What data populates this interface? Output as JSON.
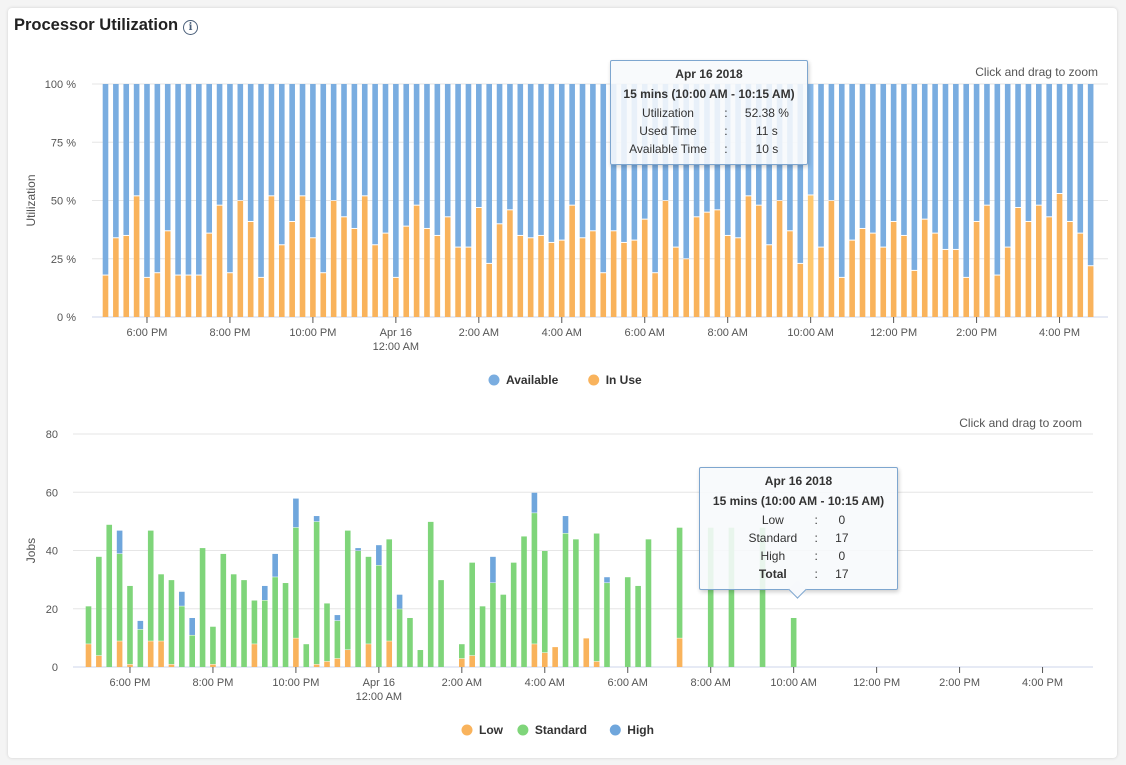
{
  "page": {
    "title": "Processor Utilization",
    "info_icon": "info-circle-icon"
  },
  "chart_data": [
    {
      "type": "bar",
      "stacked": true,
      "title": "Processor Utilization",
      "ylabel": "Utilization",
      "ylim": [
        0,
        100
      ],
      "y_ticks": [
        "0 %",
        "25 %",
        "50 %",
        "75 %",
        "100 %"
      ],
      "y_tick_values": [
        0,
        25,
        50,
        75,
        100
      ],
      "x_ticks": [
        {
          "index": 4,
          "label": "6:00 PM"
        },
        {
          "index": 12,
          "label": "8:00 PM"
        },
        {
          "index": 20,
          "label": "10:00 PM"
        },
        {
          "index": 28,
          "label": "Apr 16",
          "label2": "12:00 AM"
        },
        {
          "index": 36,
          "label": "2:00 AM"
        },
        {
          "index": 44,
          "label": "4:00 AM"
        },
        {
          "index": 52,
          "label": "6:00 AM"
        },
        {
          "index": 60,
          "label": "8:00 AM"
        },
        {
          "index": 68,
          "label": "10:00 AM"
        },
        {
          "index": 76,
          "label": "12:00 PM"
        },
        {
          "index": 84,
          "label": "2:00 PM"
        },
        {
          "index": 92,
          "label": "4:00 PM"
        }
      ],
      "interval": "15 mins",
      "zoom_hint": "Click and drag to zoom",
      "legend": [
        {
          "name": "Available",
          "color": "#7aade0"
        },
        {
          "name": "In Use",
          "color": "#f9b35c"
        }
      ],
      "legend_position": "bottom",
      "series": [
        {
          "name": "In Use",
          "color": "#f9b35c",
          "values": [
            18,
            34,
            35,
            52,
            17,
            19,
            37,
            18,
            18,
            18,
            36,
            48,
            19,
            50,
            41,
            17,
            52,
            31,
            41,
            52,
            34,
            19,
            50,
            43,
            38,
            52,
            31,
            36,
            17,
            39,
            48,
            38,
            35,
            43,
            30,
            30,
            47,
            23,
            40,
            46,
            35,
            34,
            35,
            32,
            33,
            48,
            34,
            37,
            19,
            37,
            32,
            33,
            42,
            19,
            50,
            30,
            25,
            43,
            45,
            46,
            35,
            34,
            52,
            48,
            31,
            50,
            37,
            23,
            52.38,
            30,
            50,
            17,
            33,
            38,
            36,
            30,
            41,
            35,
            20,
            42,
            36,
            29,
            29,
            17,
            41,
            48,
            18,
            30,
            47,
            41,
            48,
            43,
            53,
            41,
            36,
            22
          ]
        },
        {
          "name": "Available",
          "color": "#7aade0",
          "note": "100 minus In Use"
        }
      ],
      "highlight_index": 68,
      "tooltip": {
        "date": "Apr 16 2018",
        "range": "15 mins (10:00 AM - 10:15 AM)",
        "rows": [
          {
            "label": "Utilization",
            "value": "52.38 %"
          },
          {
            "label": "Used Time",
            "value": "11 s"
          },
          {
            "label": "Available Time",
            "value": "10 s"
          }
        ]
      }
    },
    {
      "type": "bar",
      "stacked": true,
      "ylabel": "Jobs",
      "ylim": [
        0,
        80
      ],
      "y_ticks": [
        "0",
        "20",
        "40",
        "60",
        "80"
      ],
      "y_tick_values": [
        0,
        20,
        40,
        60,
        80
      ],
      "x_ticks": [
        {
          "index": 4,
          "label": "6:00 PM"
        },
        {
          "index": 12,
          "label": "8:00 PM"
        },
        {
          "index": 20,
          "label": "10:00 PM"
        },
        {
          "index": 28,
          "label": "Apr 16",
          "label2": "12:00 AM"
        },
        {
          "index": 36,
          "label": "2:00 AM"
        },
        {
          "index": 44,
          "label": "4:00 AM"
        },
        {
          "index": 52,
          "label": "6:00 AM"
        },
        {
          "index": 60,
          "label": "8:00 AM"
        },
        {
          "index": 68,
          "label": "10:00 AM"
        },
        {
          "index": 76,
          "label": "12:00 PM"
        },
        {
          "index": 84,
          "label": "2:00 PM"
        },
        {
          "index": 92,
          "label": "4:00 PM"
        }
      ],
      "zoom_hint": "Click and drag to zoom",
      "legend": [
        {
          "name": "Low",
          "color": "#f9b35c"
        },
        {
          "name": "Standard",
          "color": "#7fd57a"
        },
        {
          "name": "High",
          "color": "#6fa6dc"
        }
      ],
      "legend_position": "bottom",
      "series": [
        {
          "name": "Low",
          "color": "#f9b35c",
          "values": [
            8,
            4,
            0,
            9,
            1,
            0,
            9,
            9,
            1,
            0,
            0,
            0,
            1,
            0,
            0,
            0,
            8,
            0,
            0,
            0,
            10,
            0,
            1,
            2,
            3,
            6,
            0,
            8,
            0,
            9,
            0,
            0,
            0,
            0,
            0,
            0,
            3,
            4,
            0,
            0,
            0,
            0,
            0,
            8,
            5,
            7,
            0,
            0,
            10,
            2,
            0,
            0,
            0,
            0,
            0,
            0,
            0,
            10,
            0,
            0,
            0,
            0,
            0,
            0,
            0,
            0,
            0,
            0,
            0,
            0,
            0,
            0,
            0,
            0,
            0,
            0,
            0,
            0,
            0,
            0,
            0,
            0,
            0,
            0,
            0,
            0,
            0,
            0,
            0,
            0,
            0,
            0,
            0,
            0,
            0,
            0
          ]
        },
        {
          "name": "Standard",
          "color": "#7fd57a",
          "values": [
            13,
            34,
            49,
            30,
            27,
            13,
            38,
            23,
            29,
            21,
            11,
            41,
            13,
            39,
            32,
            30,
            15,
            23,
            31,
            29,
            38,
            8,
            49,
            20,
            13,
            41,
            40,
            30,
            35,
            35,
            20,
            17,
            6,
            50,
            30,
            0,
            5,
            32,
            21,
            29,
            25,
            36,
            45,
            45,
            35,
            0,
            46,
            44,
            0,
            44,
            29,
            0,
            31,
            28,
            44,
            0,
            0,
            38,
            0,
            0,
            48,
            0,
            48,
            0,
            0,
            48,
            0,
            0,
            17,
            0,
            0,
            0,
            0,
            0,
            0,
            0,
            0,
            0,
            0,
            0,
            0,
            0,
            0,
            0,
            0,
            0,
            0,
            0,
            0,
            0,
            0,
            0,
            0,
            0,
            0,
            0
          ]
        },
        {
          "name": "High",
          "color": "#6fa6dc",
          "values": [
            0,
            0,
            0,
            8,
            0,
            3,
            0,
            0,
            0,
            5,
            6,
            0,
            0,
            0,
            0,
            0,
            0,
            5,
            8,
            0,
            10,
            0,
            2,
            0,
            2,
            0,
            1,
            0,
            7,
            0,
            5,
            0,
            0,
            0,
            0,
            0,
            0,
            0,
            0,
            9,
            0,
            0,
            0,
            7,
            0,
            0,
            6,
            0,
            0,
            0,
            2,
            0,
            0,
            0,
            0,
            0,
            0,
            0,
            0,
            0,
            0,
            0,
            0,
            0,
            0,
            0,
            0,
            0,
            0,
            0,
            0,
            0,
            0,
            0,
            0,
            0,
            0,
            0,
            0,
            0,
            0,
            0,
            0,
            0,
            0,
            0,
            0,
            0,
            0,
            0,
            0,
            0,
            0,
            0,
            0,
            0
          ]
        }
      ],
      "highlight_index": 68,
      "tooltip": {
        "date": "Apr 16 2018",
        "range": "15 mins (10:00 AM - 10:15 AM)",
        "rows": [
          {
            "label": "Low",
            "value": "0"
          },
          {
            "label": "Standard",
            "value": "17"
          },
          {
            "label": "High",
            "value": "0"
          },
          {
            "label": "Total",
            "value": "17",
            "bold": true
          }
        ]
      }
    }
  ]
}
